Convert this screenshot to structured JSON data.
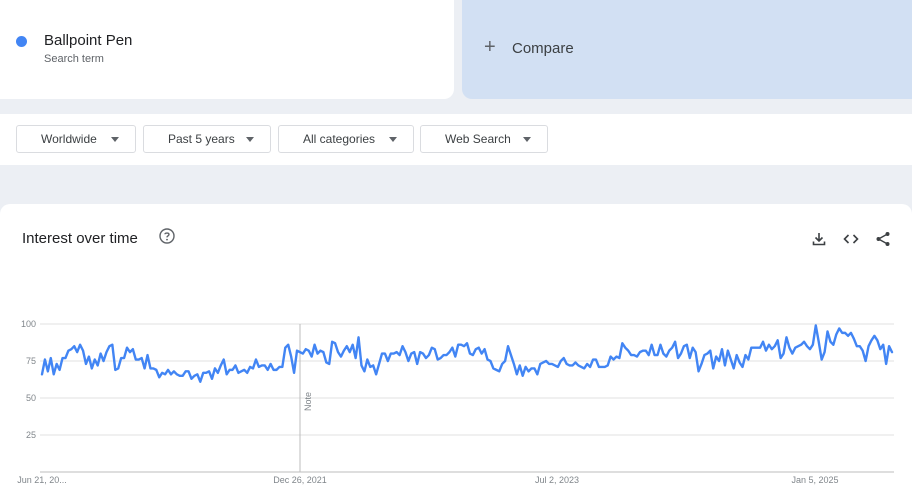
{
  "search_term": {
    "name": "Ballpoint Pen",
    "subtitle": "Search term",
    "color": "#4285f4"
  },
  "compare": {
    "label": "Compare",
    "icon": "plus-icon"
  },
  "filters": [
    {
      "label": "Worldwide"
    },
    {
      "label": "Past 5 years"
    },
    {
      "label": "All categories"
    },
    {
      "label": "Web Search"
    }
  ],
  "chart": {
    "title": "Interest over time",
    "icons": [
      "help-icon",
      "download-icon",
      "embed-icon",
      "share-icon"
    ],
    "note_label": "Note"
  },
  "chart_data": {
    "type": "line",
    "title": "Interest over time",
    "xlabel": "",
    "ylabel": "",
    "ylim": [
      0,
      100
    ],
    "yticks": [
      100,
      75,
      50,
      25
    ],
    "xticks": [
      "Jun 21, 20...",
      "Dec 26, 2021",
      "Jul 2, 2023",
      "Jan 5, 2025"
    ],
    "grid": true,
    "note_at": "Dec 26, 2021",
    "series": [
      {
        "name": "Ballpoint Pen",
        "color": "#4285f4",
        "values": [
          66,
          76,
          68,
          77,
          66,
          73,
          69,
          77,
          77,
          82,
          83,
          85,
          81,
          86,
          82,
          73,
          78,
          70,
          76,
          72,
          80,
          75,
          81,
          85,
          86,
          69,
          70,
          77,
          77,
          84,
          81,
          83,
          76,
          76,
          77,
          70,
          79,
          70,
          70,
          69,
          64,
          67,
          66,
          69,
          66,
          68,
          66,
          65,
          65,
          68,
          68,
          63,
          65,
          66,
          61,
          67,
          67,
          68,
          63,
          70,
          67,
          72,
          76,
          66,
          69,
          69,
          72,
          67,
          68,
          69,
          67,
          71,
          70,
          76,
          71,
          72,
          72,
          69,
          73,
          69,
          69,
          71,
          71,
          84,
          86,
          78,
          67,
          82,
          81,
          80,
          83,
          82,
          78,
          86,
          80,
          82,
          81,
          74,
          73,
          88,
          87,
          81,
          78,
          82,
          85,
          81,
          86,
          77,
          91,
          72,
          68,
          76,
          71,
          72,
          66,
          73,
          80,
          80,
          75,
          80,
          80,
          81,
          79,
          85,
          81,
          75,
          80,
          81,
          73,
          81,
          80,
          77,
          79,
          84,
          83,
          76,
          77,
          79,
          79,
          81,
          84,
          78,
          86,
          86,
          85,
          87,
          80,
          79,
          83,
          84,
          80,
          83,
          76,
          75,
          70,
          69,
          68,
          73,
          75,
          85,
          79,
          73,
          66,
          72,
          65,
          71,
          68,
          70,
          70,
          66,
          73,
          74,
          75,
          73,
          73,
          72,
          71,
          75,
          77,
          73,
          72,
          72,
          74,
          72,
          71,
          70,
          73,
          71,
          76,
          76,
          71,
          71,
          71,
          72,
          78,
          76,
          78,
          77,
          87,
          84,
          82,
          79,
          79,
          78,
          81,
          82,
          82,
          79,
          86,
          79,
          79,
          86,
          80,
          78,
          82,
          84,
          88,
          77,
          80,
          85,
          86,
          77,
          84,
          81,
          68,
          73,
          79,
          80,
          82,
          70,
          78,
          75,
          83,
          72,
          82,
          76,
          70,
          79,
          74,
          71,
          79,
          76,
          84,
          84,
          84,
          84,
          88,
          82,
          86,
          83,
          85,
          89,
          77,
          80,
          91,
          84,
          80,
          84,
          85,
          86,
          88,
          85,
          83,
          86,
          99,
          88,
          76,
          81,
          95,
          88,
          86,
          93,
          97,
          94,
          94,
          92,
          94,
          90,
          85,
          85,
          82,
          75,
          85,
          89,
          92,
          89,
          83,
          86,
          73,
          85,
          81
        ]
      }
    ]
  }
}
